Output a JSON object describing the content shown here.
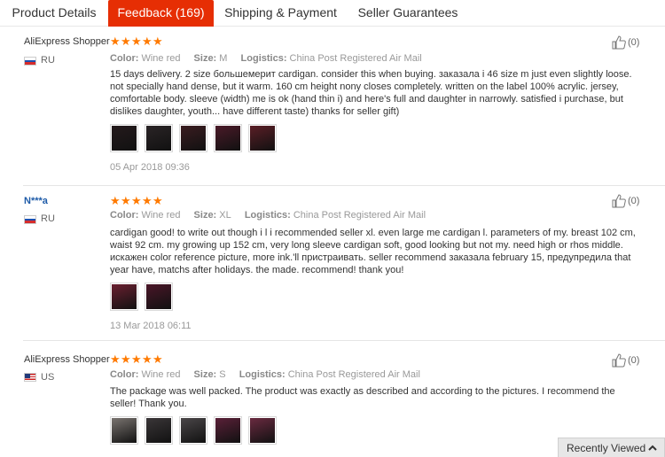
{
  "tabs": [
    {
      "label": "Product Details",
      "active": false
    },
    {
      "label": "Feedback (169)",
      "active": true
    },
    {
      "label": "Shipping & Payment",
      "active": false
    },
    {
      "label": "Seller Guarantees",
      "active": false
    }
  ],
  "attr_labels": {
    "color": "Color:",
    "size": "Size:",
    "logistics": "Logistics:"
  },
  "reviews": [
    {
      "user": "AliExpress Shopper",
      "country": "RU",
      "flag": "ru",
      "stars": 5,
      "color": "Wine red",
      "size": "M",
      "logistics": "China Post Registered Air Mail",
      "text": "15 days delivery. 2 size большемерит cardigan. consider this when buying. заказала i 46 size m just even slightly loose. not specially hand dense, but it warm. 160 cm height nony closes completely. written on the label 100% acrylic. jersey, comfortable body. sleeve (width) me is ok (hand thin i) and here's full and daughter in narrowly. satisfied i purchase, but dislikes daughter, youth... have different taste) thanks for seller gift)",
      "photo_colors": [
        "#241a1c",
        "#2a2426",
        "#3a1c20",
        "#4a1a28",
        "#5a1e26"
      ],
      "date": "05 Apr 2018 09:36",
      "helpful": "(0)"
    },
    {
      "user": "N***a",
      "country": "RU",
      "flag": "ru",
      "stars": 5,
      "color": "Wine red",
      "size": "XL",
      "logistics": "China Post Registered Air Mail",
      "text": "cardigan good! to write out though i l i recommended seller xl. even large me cardigan l. parameters of my. breast 102 cm, waist 92 cm. my growing up 152 cm, very long sleeve cardigan soft, good looking but not my. need high or rhos middle. искажен color reference picture, more ink.'ll пристраивать. seller recommend заказала february 15, предупредила that year have, matchs after holidays. the made. recommend! thank you!",
      "photo_colors": [
        "#6a2030",
        "#4a1628"
      ],
      "date": "13 Mar 2018 06:11",
      "helpful": "(0)"
    },
    {
      "user": "AliExpress Shopper",
      "country": "US",
      "flag": "us",
      "stars": 5,
      "color": "Wine red",
      "size": "S",
      "logistics": "China Post Registered Air Mail",
      "text": "The package was well packed. The product was exactly as described and according to the pictures. I recommend the seller! Thank you.",
      "photo_colors": [
        "#7a7470",
        "#3a3638",
        "#4a4648",
        "#5a2038",
        "#6a2a40"
      ],
      "date": "",
      "helpful": "(0)"
    }
  ],
  "recently_viewed": "Recently Viewed",
  "colors": {
    "accent": "#e62e04",
    "star": "#ff7a00",
    "link": "#1e5ba8"
  },
  "icons": {
    "helpful": "thumbs-up-icon",
    "collapse": "chevron-up-icon"
  }
}
